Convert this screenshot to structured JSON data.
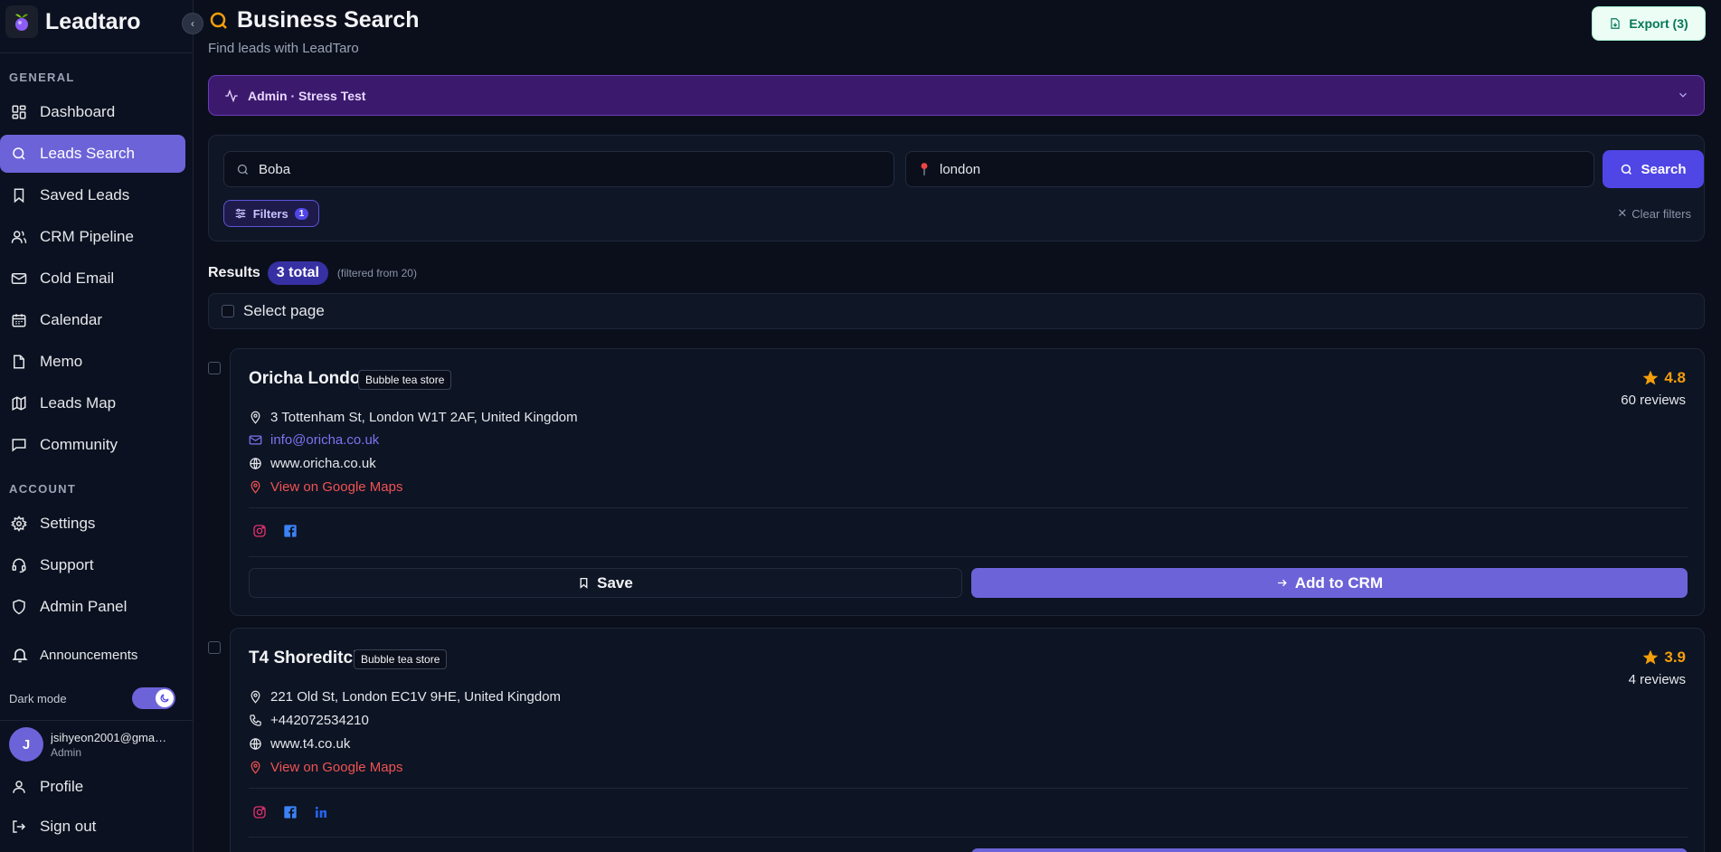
{
  "brand": {
    "name": "Leadtaro"
  },
  "sidebar": {
    "general_label": "GENERAL",
    "general_items": [
      {
        "label": "Dashboard",
        "icon": "dashboard-icon",
        "active": false
      },
      {
        "label": "Leads Search",
        "icon": "search-icon",
        "active": true
      },
      {
        "label": "Saved Leads",
        "icon": "bookmark-icon",
        "active": false
      },
      {
        "label": "CRM Pipeline",
        "icon": "users-icon",
        "active": false
      },
      {
        "label": "Cold Email",
        "icon": "mail-icon",
        "active": false
      },
      {
        "label": "Calendar",
        "icon": "calendar-icon",
        "active": false
      },
      {
        "label": "Memo",
        "icon": "file-icon",
        "active": false
      },
      {
        "label": "Leads Map",
        "icon": "map-icon",
        "active": false
      },
      {
        "label": "Community",
        "icon": "chat-icon",
        "active": false
      }
    ],
    "account_label": "ACCOUNT",
    "account_items": [
      {
        "label": "Settings",
        "icon": "gear-icon"
      },
      {
        "label": "Support",
        "icon": "headset-icon"
      },
      {
        "label": "Admin Panel",
        "icon": "shield-icon"
      }
    ],
    "announcements": "Announcements",
    "dark_mode_label": "Dark mode",
    "dark_mode_on": true,
    "user": {
      "initial": "J",
      "email": "jsihyeon2001@gmail.com",
      "role": "Admin"
    },
    "profile": "Profile",
    "sign_out": "Sign out"
  },
  "header": {
    "title": "Business Search",
    "subtitle": "Find leads with LeadTaro",
    "export_label": "Export (3)"
  },
  "admin_bar": {
    "label": "Admin · Stress Test"
  },
  "search": {
    "query": "Boba",
    "location": "london",
    "search_label": "Search",
    "filters_label": "Filters",
    "filters_count": "1",
    "clear_label": "Clear filters"
  },
  "results": {
    "label": "Results",
    "total": "3 total",
    "note": "(filtered from 20)",
    "select_page": "Select page"
  },
  "leads": [
    {
      "name": "Oricha London",
      "category": "Bubble tea store",
      "rating": "4.8",
      "reviews": "60 reviews",
      "address": "3 Tottenham St, London W1T 2AF, United Kingdom",
      "email": "info@oricha.co.uk",
      "website": "www.oricha.co.uk",
      "maps": "View on Google Maps",
      "socials": [
        "instagram-icon",
        "facebook-icon"
      ],
      "save": "Save",
      "add_crm": "Add to CRM"
    },
    {
      "name": "T4 Shoreditch",
      "category": "Bubble tea store",
      "rating": "3.9",
      "reviews": "4 reviews",
      "address": "221 Old St, London EC1V 9HE, United Kingdom",
      "phone": "+442072534210",
      "website": "www.t4.co.uk",
      "maps": "View on Google Maps",
      "socials": [
        "instagram-icon",
        "facebook-icon",
        "linkedin-icon"
      ]
    }
  ],
  "colors": {
    "accent": "#6d63d8",
    "primary_button": "#4f46e5",
    "admin_bar": "#3b1a6e",
    "rating": "#f59e0b",
    "maps_link": "#f05252",
    "export": "#047857"
  }
}
